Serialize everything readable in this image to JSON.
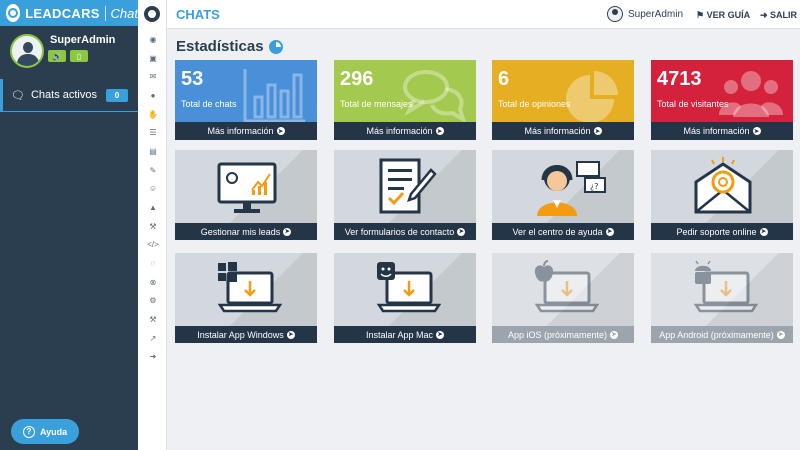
{
  "brand": {
    "name": "LEADCARS",
    "product": "Chat"
  },
  "sidebar": {
    "user_name": "SuperAdmin",
    "nav_item": "Chats activos",
    "nav_badge": "0",
    "help_label": "Ayuda"
  },
  "topbar": {
    "title": "CHATS",
    "user_name": "SuperAdmin",
    "guide_label": "VER GUÍA",
    "logout_label": "SALIR"
  },
  "section_title": "Estadísticas",
  "stats": [
    {
      "value": "53",
      "label": "Total de chats",
      "link": "Más información",
      "color": "#4a90d9",
      "icon": "bar-chart-icon"
    },
    {
      "value": "296",
      "label": "Total de mensajes",
      "link": "Más información",
      "color": "#a3c94f",
      "icon": "chat-bubbles-icon"
    },
    {
      "value": "6",
      "label": "Total de opiniones",
      "link": "Más información",
      "color": "#e5ae23",
      "icon": "pie-chart-icon"
    },
    {
      "value": "4713",
      "label": "Total de visitantes",
      "link": "Más información",
      "color": "#d4213c",
      "icon": "users-icon"
    }
  ],
  "tiles_row1": [
    {
      "label": "Gestionar mis leads",
      "icon": "monitor-chart-icon"
    },
    {
      "label": "Ver formularios de contacto",
      "icon": "form-pencil-icon"
    },
    {
      "label": "Ver el centro de ayuda",
      "icon": "support-agent-icon"
    },
    {
      "label": "Pedir soporte online",
      "icon": "envelope-support-icon"
    }
  ],
  "tiles_row2": [
    {
      "label": "Instalar App Windows",
      "icon": "windows-laptop-icon"
    },
    {
      "label": "Instalar App Mac",
      "icon": "mac-laptop-icon"
    },
    {
      "label": "App iOS (próximamente)",
      "icon": "apple-laptop-icon"
    },
    {
      "label": "App Android (próximamente)",
      "icon": "android-laptop-icon"
    }
  ],
  "colors": {
    "accent": "#3aa0db",
    "sidebar": "#2b3e50",
    "footer": "#253548",
    "status_green": "#8dc63f"
  }
}
